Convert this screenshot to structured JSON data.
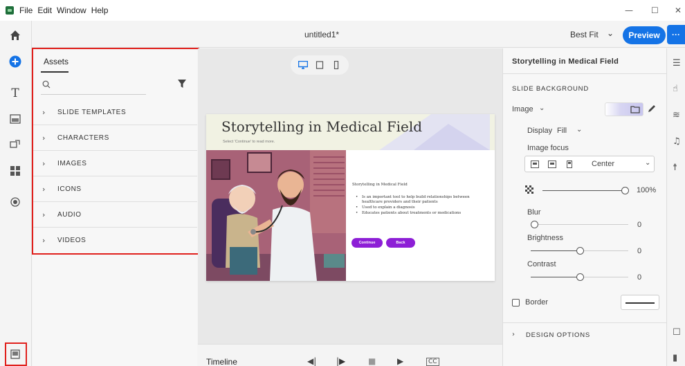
{
  "menu": {
    "items": [
      "File",
      "Edit",
      "Window",
      "Help"
    ]
  },
  "window_controls": {
    "minimize": "—",
    "maximize": "☐",
    "close": "✕"
  },
  "toolbar": {
    "doc_title": "untitled1*",
    "zoom": "Best Fit",
    "preview": "Preview",
    "more": "···"
  },
  "left_rail": {
    "icons": [
      "home-icon",
      "add-icon",
      "text-icon",
      "media-icon",
      "interactions-icon",
      "widgets-icon",
      "record-icon",
      "slide-panel-icon"
    ]
  },
  "assets": {
    "tab": "Assets",
    "search_placeholder": "",
    "categories": [
      "SLIDE TEMPLATES",
      "CHARACTERS",
      "IMAGES",
      "ICONS",
      "AUDIO",
      "VIDEOS"
    ]
  },
  "canvas": {
    "device_modes": [
      "desktop",
      "tablet",
      "mobile"
    ],
    "active_device": "desktop"
  },
  "slide": {
    "title": "Storytelling in Medical Field",
    "subtitle": "Select 'Continue' to read more.",
    "body_title": "Storytelling in Medical Field",
    "bullets": [
      "Is an important tool to help build relationships between healthcare providers and their patients",
      "Used to explain a diagnosis",
      "Educates patients about treatments or medications"
    ],
    "continue": "Continue",
    "back": "Back"
  },
  "timeline": {
    "label": "Timeline"
  },
  "properties": {
    "title": "Storytelling in Medical Field",
    "section": "SLIDE BACKGROUND",
    "bg_type": "Image",
    "display_label": "Display",
    "display_value": "Fill",
    "image_focus_label": "Image focus",
    "image_focus_value": "Center",
    "opacity_value": "100%",
    "opacity_level": 1.0,
    "blur_label": "Blur",
    "blur_value": "0",
    "brightness_label": "Brightness",
    "brightness_value": "0",
    "contrast_label": "Contrast",
    "contrast_value": "0",
    "border_label": "Border",
    "border_checked": false,
    "design_options": "DESIGN OPTIONS"
  },
  "colors": {
    "accent": "#1473e6",
    "slide_button": "#8d1fd6",
    "highlight": "#e0201c"
  }
}
